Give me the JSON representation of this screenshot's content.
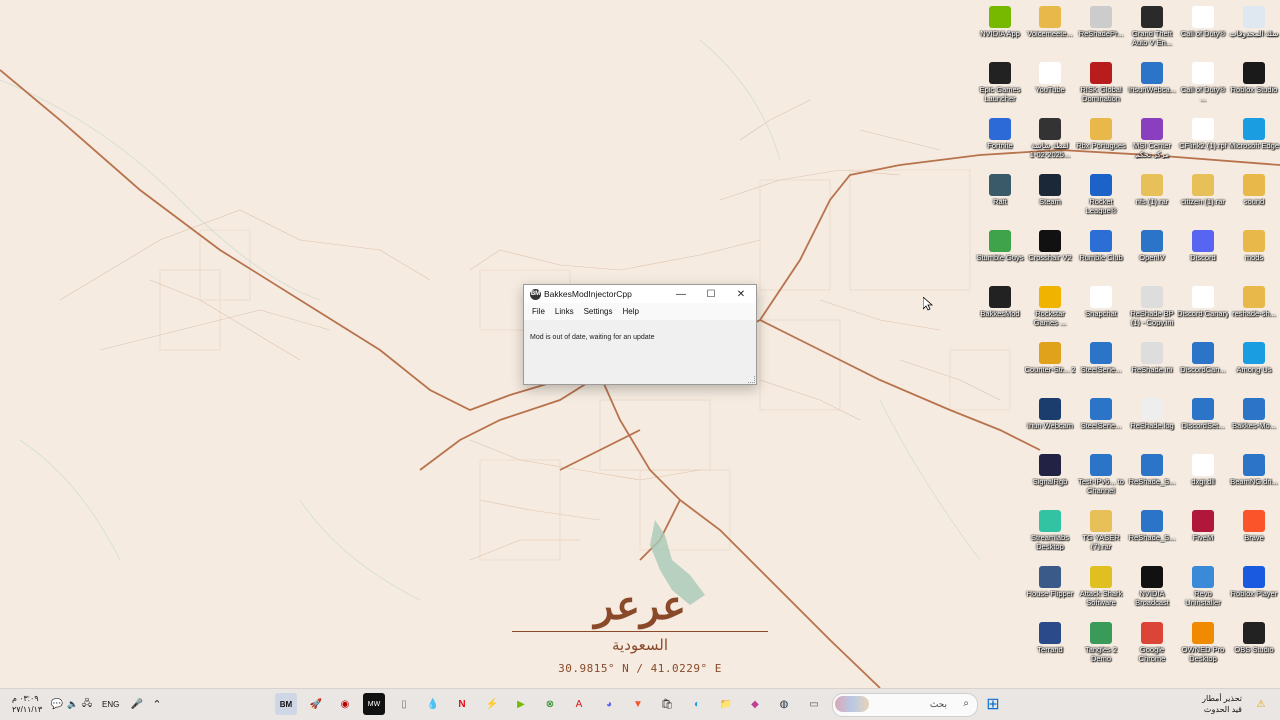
{
  "wallpaper": {
    "city_name": "عرعر",
    "country": "السعودية",
    "coordinates": "30.9815° N / 41.0229° E"
  },
  "desktop_icons": [
    {
      "label": "NVIDIA App",
      "icon": "nvidia-app-icon",
      "color": "#76b900"
    },
    {
      "label": "Voicemeete...",
      "icon": "folder-icon",
      "color": "#e8b84a"
    },
    {
      "label": "ReShadePr...",
      "icon": "file-icon",
      "color": "#cccccc"
    },
    {
      "label": "Grand Theft Auto V En...",
      "icon": "gta-icon",
      "color": "#2a2a2a"
    },
    {
      "label": "Call of Duty®",
      "icon": "file-icon",
      "color": "#ffffff"
    },
    {
      "label": "سلة المحذوفات",
      "icon": "recycle-bin-icon",
      "color": "#dfe8f0"
    },
    {
      "label": "Epic Games Launcher",
      "icon": "epic-games-icon",
      "color": "#222222"
    },
    {
      "label": "YouTube",
      "icon": "shortcut-icon",
      "color": "#ffffff"
    },
    {
      "label": "RISK Global Domination",
      "icon": "risk-icon",
      "color": "#b81c1c"
    },
    {
      "label": "IrisunWebca...",
      "icon": "app-icon",
      "color": "#2b74c7"
    },
    {
      "label": "Call of Duty® ...",
      "icon": "file-icon",
      "color": "#ffffff"
    },
    {
      "label": "Roblox Studio",
      "icon": "roblox-studio-icon",
      "color": "#1a1a1a"
    },
    {
      "label": "Fortnite",
      "icon": "fortnite-icon",
      "color": "#2c6ad8"
    },
    {
      "label": "لقطة شاشة 2025-02-1...",
      "icon": "screenshot-icon",
      "color": "#333333"
    },
    {
      "label": "Rbx Portugues",
      "icon": "folder-icon",
      "color": "#e8b84a"
    },
    {
      "label": "MSI Center مركز تحكم",
      "icon": "msi-center-icon",
      "color": "#8a3fbf"
    },
    {
      "label": "CFlink2 (1).rpf",
      "icon": "file-icon",
      "color": "#ffffff"
    },
    {
      "label": "Microsoft Edge",
      "icon": "edge-icon",
      "color": "#1b9de2"
    },
    {
      "label": "Raft",
      "icon": "raft-icon",
      "color": "#3a5a6a"
    },
    {
      "label": "Steam",
      "icon": "steam-icon",
      "color": "#1b2838"
    },
    {
      "label": "Rocket League®",
      "icon": "rocket-league-icon",
      "color": "#1d62c9"
    },
    {
      "label": "nfs (1).rar",
      "icon": "archive-icon",
      "color": "#e8c05a"
    },
    {
      "label": "citizen (1).rar",
      "icon": "archive-icon",
      "color": "#e8c05a"
    },
    {
      "label": "sound",
      "icon": "folder-icon",
      "color": "#e8b84a"
    },
    {
      "label": "Stumble Guys",
      "icon": "stumble-guys-icon",
      "color": "#3ea34a"
    },
    {
      "label": "Crosshair V2",
      "icon": "crosshair-icon",
      "color": "#111111"
    },
    {
      "label": "Rumble Club",
      "icon": "rumble-club-icon",
      "color": "#2b6fd6"
    },
    {
      "label": "OpenIV",
      "icon": "openiv-icon",
      "color": "#2b74c7"
    },
    {
      "label": "Discord",
      "icon": "discord-icon",
      "color": "#5865f2"
    },
    {
      "label": "mods",
      "icon": "folder-icon",
      "color": "#e8b84a"
    },
    {
      "label": "BakkesMod",
      "icon": "bakkesmod-icon",
      "color": "#222222"
    },
    {
      "label": "Rockstar Games ...",
      "icon": "rockstar-icon",
      "color": "#f0b300"
    },
    {
      "label": "Snapchat",
      "icon": "file-icon",
      "color": "#ffffff"
    },
    {
      "label": "ReShade BP (1) - Copy.ini",
      "icon": "file-icon",
      "color": "#dddddd"
    },
    {
      "label": "Discord Canary",
      "icon": "file-icon",
      "color": "#ffffff"
    },
    {
      "label": "reshade-sh...",
      "icon": "folder-icon",
      "color": "#e8b84a"
    },
    {
      "label": "Counter-Str... 2",
      "icon": "counter-strike-icon",
      "color": "#e0a21a"
    },
    {
      "label": "SteelSerie...",
      "icon": "app-icon",
      "color": "#2b74c7"
    },
    {
      "label": "ReShade.ini",
      "icon": "file-icon",
      "color": "#dddddd"
    },
    {
      "label": "DiscordCan...",
      "icon": "app-icon",
      "color": "#2b74c7"
    },
    {
      "label": "Among Us",
      "icon": "among-us-icon",
      "color": "#1b9de2"
    },
    {
      "label": "Iriun Webcam",
      "icon": "iriun-webcam-icon",
      "color": "#1a3d6e"
    },
    {
      "label": "SteelSerie...",
      "icon": "app-icon",
      "color": "#2b74c7"
    },
    {
      "label": "ReShade.log",
      "icon": "file-icon",
      "color": "#eeeeee"
    },
    {
      "label": "DiscordSet...",
      "icon": "app-icon",
      "color": "#2b74c7"
    },
    {
      "label": "Bakkes-Mo...",
      "icon": "app-icon",
      "color": "#2b74c7"
    },
    {
      "label": "SignalRgb",
      "icon": "signalrgb-icon",
      "color": "#222244"
    },
    {
      "label": "Test-IPv6... to Channel",
      "icon": "globe-icon",
      "color": "#2b74c7"
    },
    {
      "label": "ReShade_S...",
      "icon": "app-icon",
      "color": "#2b74c7"
    },
    {
      "label": "dxgi.dll",
      "icon": "file-icon",
      "color": "#ffffff"
    },
    {
      "label": "BeamNG.dri...",
      "icon": "globe-icon",
      "color": "#2b74c7"
    },
    {
      "label": "Streamlabs Desktop",
      "icon": "streamlabs-icon",
      "color": "#31c3a2"
    },
    {
      "label": "TG YASER (7).rar",
      "icon": "archive-icon",
      "color": "#e8c05a"
    },
    {
      "label": "ReShade_S...",
      "icon": "app-icon",
      "color": "#2b74c7"
    },
    {
      "label": "FiveM",
      "icon": "fivem-icon",
      "color": "#b0173a"
    },
    {
      "label": "Brave",
      "icon": "brave-icon",
      "color": "#fb542b"
    },
    {
      "label": "House Flipper",
      "icon": "house-flipper-icon",
      "color": "#3a5a8a"
    },
    {
      "label": "Attack Shark Software",
      "icon": "attack-shark-icon",
      "color": "#e0c020"
    },
    {
      "label": "NVIDIA Broadcast",
      "icon": "nvidia-broadcast-icon",
      "color": "#111111"
    },
    {
      "label": "Revo Uninstaller",
      "icon": "revo-uninstaller-icon",
      "color": "#3a8ad8"
    },
    {
      "label": "Roblox Player",
      "icon": "roblox-player-icon",
      "color": "#1a5ae0"
    },
    {
      "label": "Terrarid",
      "icon": "terraria-icon",
      "color": "#2a4a8a"
    },
    {
      "label": "Tangles 2 Demo",
      "icon": "tangles-icon",
      "color": "#3a9a5a"
    },
    {
      "label": "Google Chrome",
      "icon": "chrome-icon",
      "color": "#db4437"
    },
    {
      "label": "OWNED Pro Desktop",
      "icon": "owned-pro-icon",
      "color": "#f08a00"
    },
    {
      "label": "OBS Studio",
      "icon": "obs-studio-icon",
      "color": "#222222"
    }
  ],
  "dialog": {
    "title": "BakkesModInjectorCpp",
    "app_icon_text": "BM",
    "minimize": "—",
    "maximize": "☐",
    "close": "✕",
    "menu": [
      "File",
      "Links",
      "Settings",
      "Help"
    ],
    "status": "Mod is out of date, waiting for an update"
  },
  "taskbar": {
    "search_placeholder": "بحث",
    "weather_title": "تحذير أمطار",
    "weather_sub": "قيد الحدوث",
    "language": "ENG",
    "time": "٠٣:٠٩ م",
    "date": "٢٧/١١/١٣"
  }
}
